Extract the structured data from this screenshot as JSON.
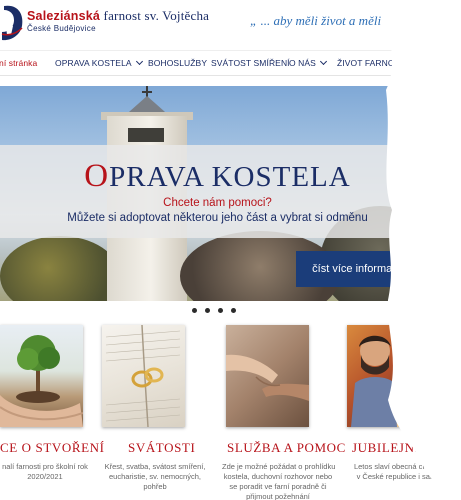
{
  "header": {
    "brand_bold": "Saleziánská",
    "brand_rest": "farnost sv. Vojtěcha",
    "brand_sub": "České Budějovice",
    "motto": "„ ... aby měli život a měli"
  },
  "nav": {
    "items": [
      {
        "label": "ní stránka",
        "dropdown": false,
        "active": true
      },
      {
        "label": "OPRAVA KOSTELA",
        "dropdown": true,
        "active": false
      },
      {
        "label": "BOHOSLUŽBY",
        "dropdown": false,
        "active": false
      },
      {
        "label": "SVÁTOST SMÍŘENÍ",
        "dropdown": false,
        "active": false
      },
      {
        "label": "O NÁS",
        "dropdown": true,
        "active": false
      },
      {
        "label": "ŽIVOT FARNO",
        "dropdown": false,
        "active": false
      }
    ]
  },
  "hero": {
    "title_first": "O",
    "title_rest": "PRAVA KOSTELA",
    "subtitle1": "Chcete nám pomoci?",
    "subtitle2": "Můžete si adoptovat některou jeho část a vybrat si odměnu",
    "cta": "číst více informací",
    "slides": 4
  },
  "cards": [
    {
      "title": "CE O STVOŘENÍ",
      "lines": [
        "nalí farnosti pro školní rok",
        "2020/2021"
      ],
      "image": "plant-in-hands"
    },
    {
      "title": "SVÁTOSTI",
      "lines": [
        "Křest, svatba, svátost smíření,",
        "eucharistie, sv. nemocných,",
        "pohřeb"
      ],
      "image": "rings-on-bible"
    },
    {
      "title": "SLUŽBA A POMOC",
      "lines": [
        "Zde je možné požádat o prohlídku",
        "kostela, duchovní rozhovor nebo",
        "se poradit ve farní poradně či",
        "přijmout požehnání"
      ],
      "image": "holding-hands"
    },
    {
      "title": "JUBILEJNÍ ROK",
      "lines": [
        "Letos slaví obecná církev, cí",
        "v České republice i salesiá"
      ],
      "image": "saint-joseph"
    }
  ],
  "colors": {
    "navy": "#1b2d66",
    "red": "#b7131a",
    "cta": "#1b3d7a"
  }
}
